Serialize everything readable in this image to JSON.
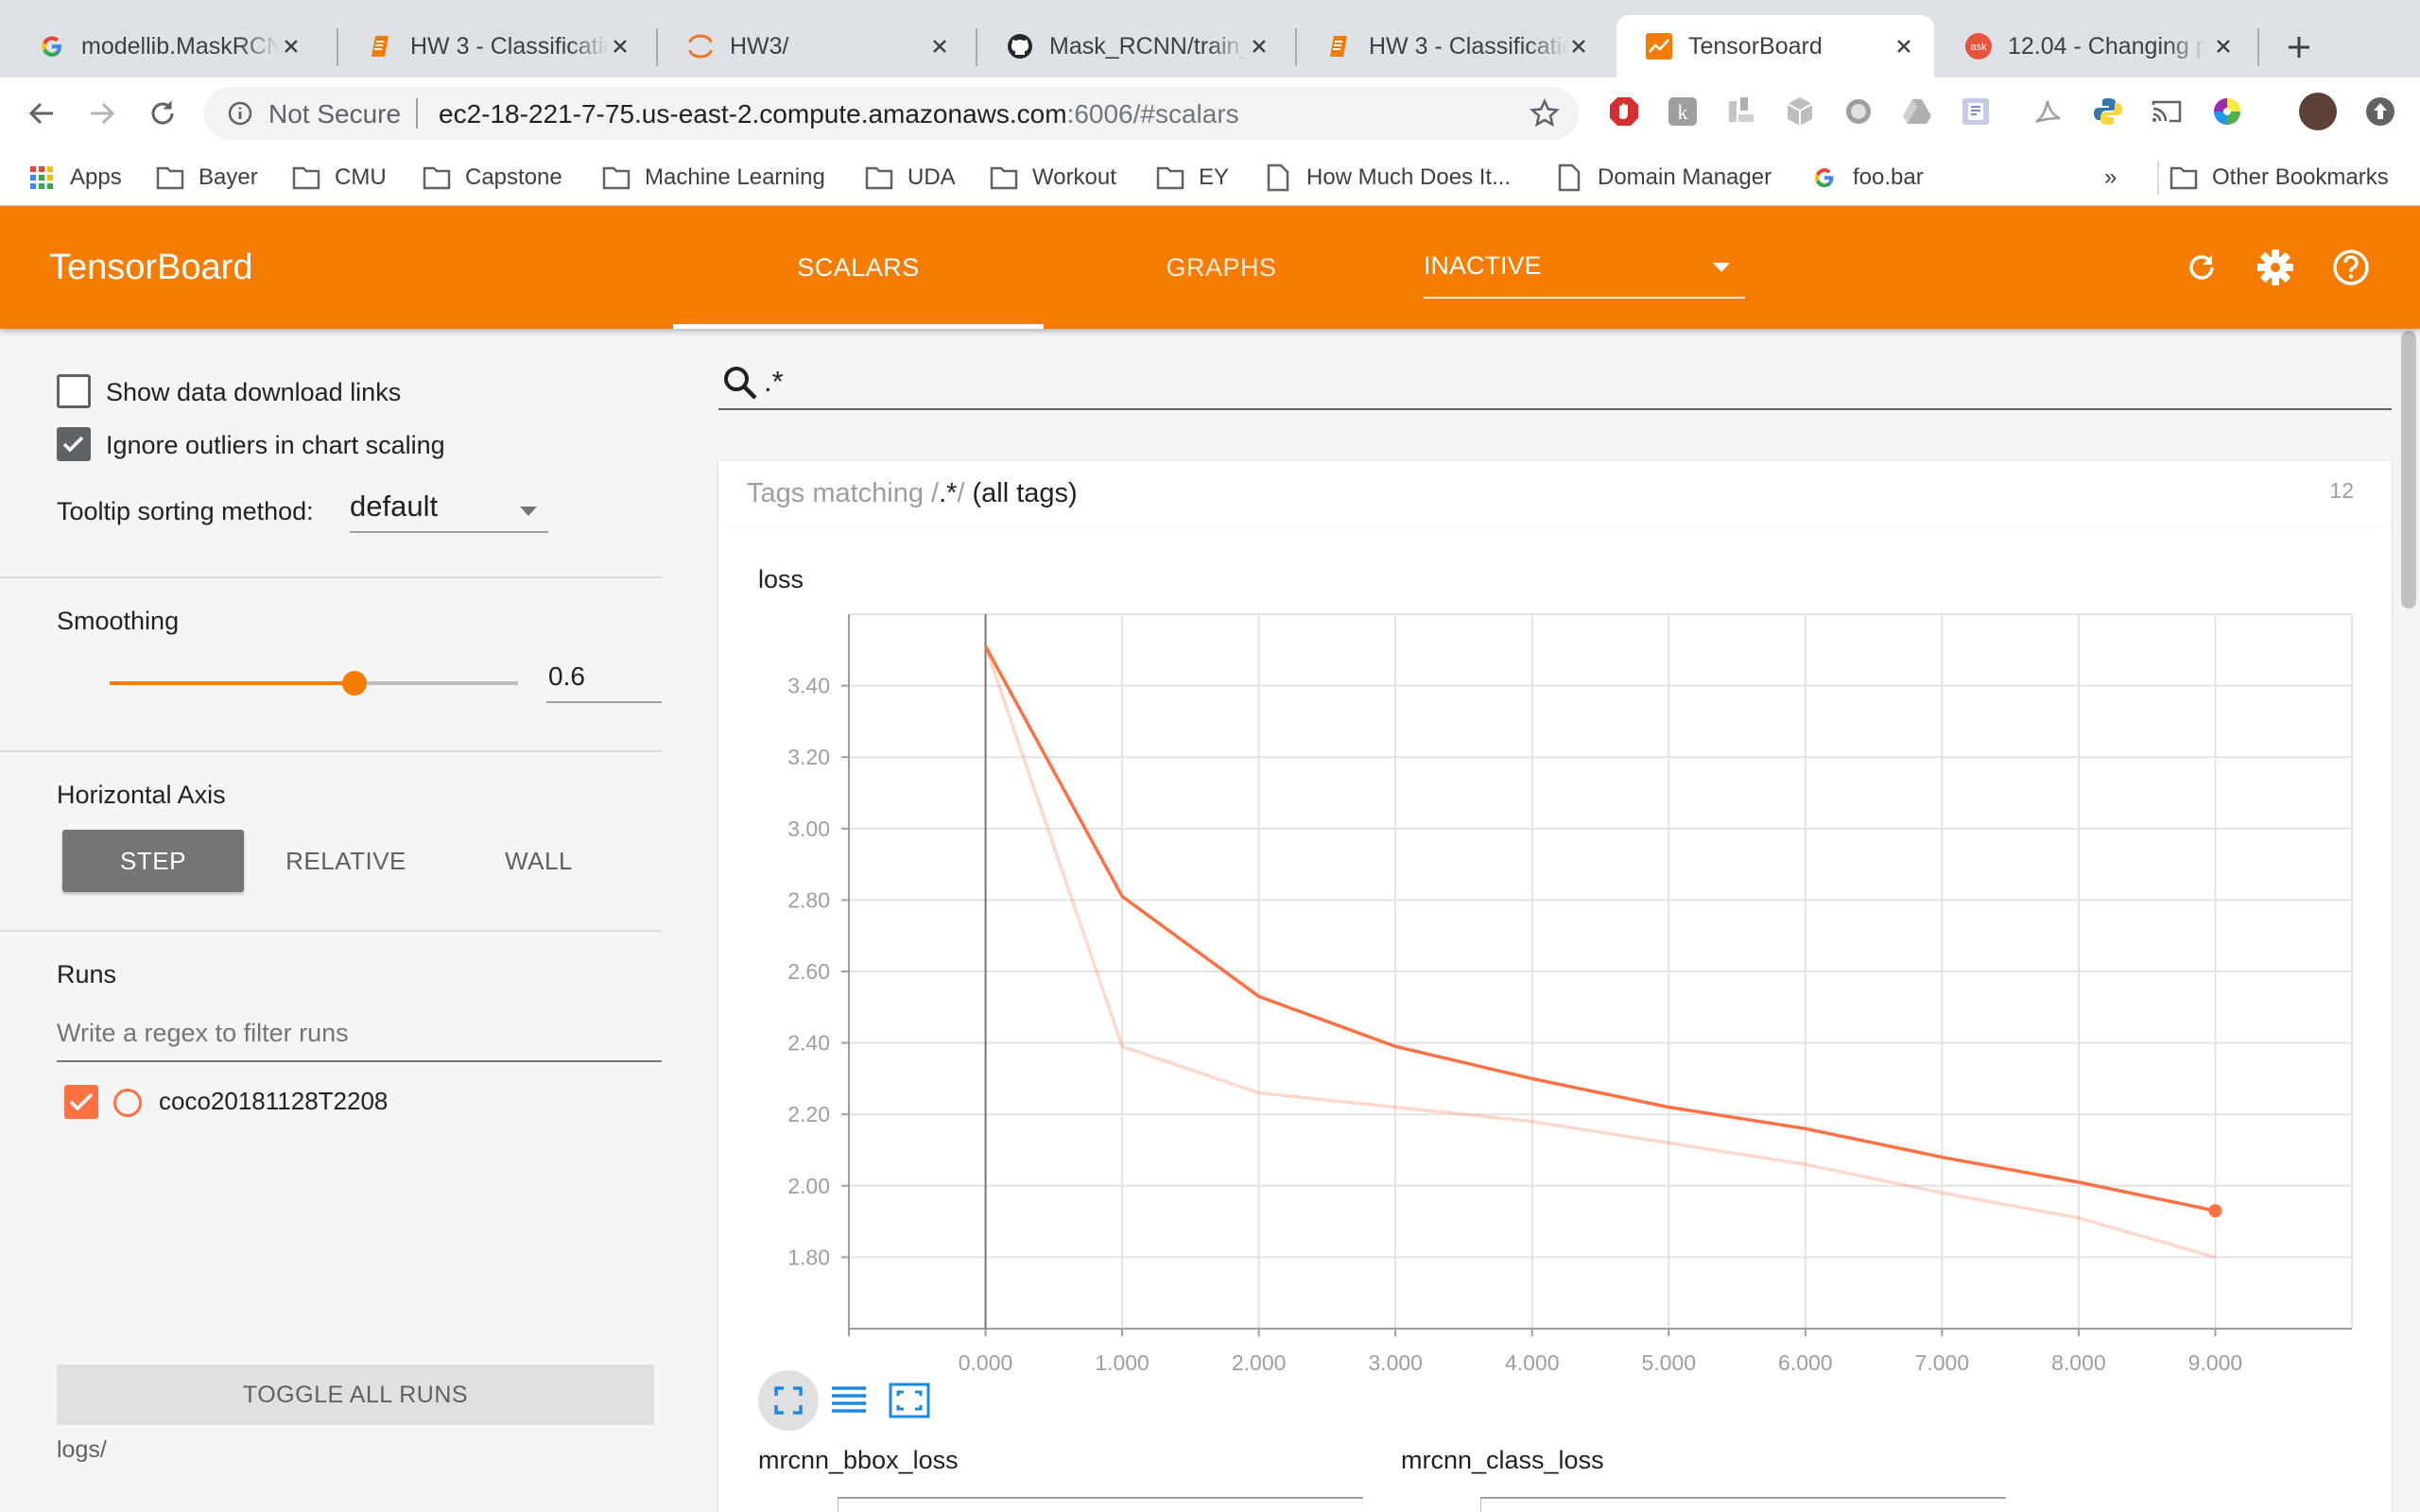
{
  "browser": {
    "tabs": [
      {
        "title": "modellib.MaskRCNN",
        "icon": "google-icon"
      },
      {
        "title": "HW 3 - Classification",
        "icon": "document-icon"
      },
      {
        "title": "HW3/",
        "icon": "jupyter-icon"
      },
      {
        "title": "Mask_RCNN/train_",
        "icon": "github-icon"
      },
      {
        "title": "HW 3 - Classification",
        "icon": "document-icon"
      },
      {
        "title": "TensorBoard",
        "icon": "tensorboard-icon",
        "active": true
      },
      {
        "title": "12.04 - Changing p",
        "icon": "ask-icon"
      }
    ],
    "omnibox": {
      "security": "Not Secure",
      "url_main": "ec2-18-221-7-75.us-east-2.compute.amazonaws.com",
      "url_rest": ":6006/#scalars"
    },
    "bookmarks": [
      "Apps",
      "Bayer",
      "CMU",
      "Capstone",
      "Machine Learning",
      "UDA",
      "Workout",
      "EY",
      "How Much Does It...",
      "Domain Manager",
      "foo.bar"
    ],
    "bookmarks_overflow": "»",
    "other_bookmarks": "Other Bookmarks"
  },
  "header": {
    "brand": "TensorBoard",
    "tabs": {
      "scalars": "SCALARS",
      "graphs": "GRAPHS",
      "inactive": "INACTIVE"
    }
  },
  "sidebar": {
    "show_download_links": {
      "label": "Show data download links",
      "checked": false
    },
    "ignore_outliers": {
      "label": "Ignore outliers in chart scaling",
      "checked": true
    },
    "tooltip_sorting": {
      "label": "Tooltip sorting method:",
      "value": "default"
    },
    "smoothing": {
      "label": "Smoothing",
      "value": "0.6",
      "level": 0.6
    },
    "horizontal_axis": {
      "label": "Horizontal Axis",
      "options": [
        "STEP",
        "RELATIVE",
        "WALL"
      ],
      "selected": "STEP"
    },
    "runs": {
      "label": "Runs",
      "filter_placeholder": "Write a regex to filter runs",
      "items": [
        {
          "name": "coco20181128T2208",
          "color": "#ff7043",
          "checked": true
        }
      ],
      "toggle_all": "TOGGLE ALL RUNS",
      "logdir": "logs/"
    }
  },
  "main": {
    "search_value": ".*",
    "tags": {
      "prefix": "Tags matching /",
      "regex": ".*",
      "suffix": "/",
      "all": "(all tags)",
      "count": "12"
    },
    "charts": {
      "loss_title": "loss",
      "sub_titles": [
        "mrcnn_bbox_loss",
        "mrcnn_class_loss"
      ]
    }
  },
  "colors": {
    "accent": "#f57c00",
    "series": "#ff7043"
  },
  "chart_data": {
    "type": "line",
    "title": "loss",
    "xlabel": "",
    "ylabel": "",
    "x": [
      0,
      1,
      2,
      3,
      4,
      5,
      6,
      7,
      8,
      9
    ],
    "x_tick_labels": [
      "0.000",
      "1.000",
      "2.000",
      "3.000",
      "4.000",
      "5.000",
      "6.000",
      "7.000",
      "8.000",
      "9.000"
    ],
    "xlim": [
      -1,
      10
    ],
    "ylim": [
      1.6,
      3.6
    ],
    "y_tick_values": [
      1.8,
      2.0,
      2.2,
      2.4,
      2.6,
      2.8,
      3.0,
      3.2,
      3.4
    ],
    "y_tick_labels": [
      "1.80",
      "2.00",
      "2.20",
      "2.40",
      "2.60",
      "2.80",
      "3.00",
      "3.20",
      "3.40"
    ],
    "grid": true,
    "series": [
      {
        "name": "coco20181128T2208",
        "kind": "smoothed",
        "values": [
          3.51,
          2.81,
          2.53,
          2.39,
          2.3,
          2.22,
          2.16,
          2.08,
          2.01,
          1.93
        ]
      },
      {
        "name": "coco20181128T2208",
        "kind": "raw",
        "values": [
          3.51,
          2.39,
          2.26,
          2.22,
          2.18,
          2.12,
          2.06,
          1.98,
          1.91,
          1.8
        ]
      }
    ]
  }
}
